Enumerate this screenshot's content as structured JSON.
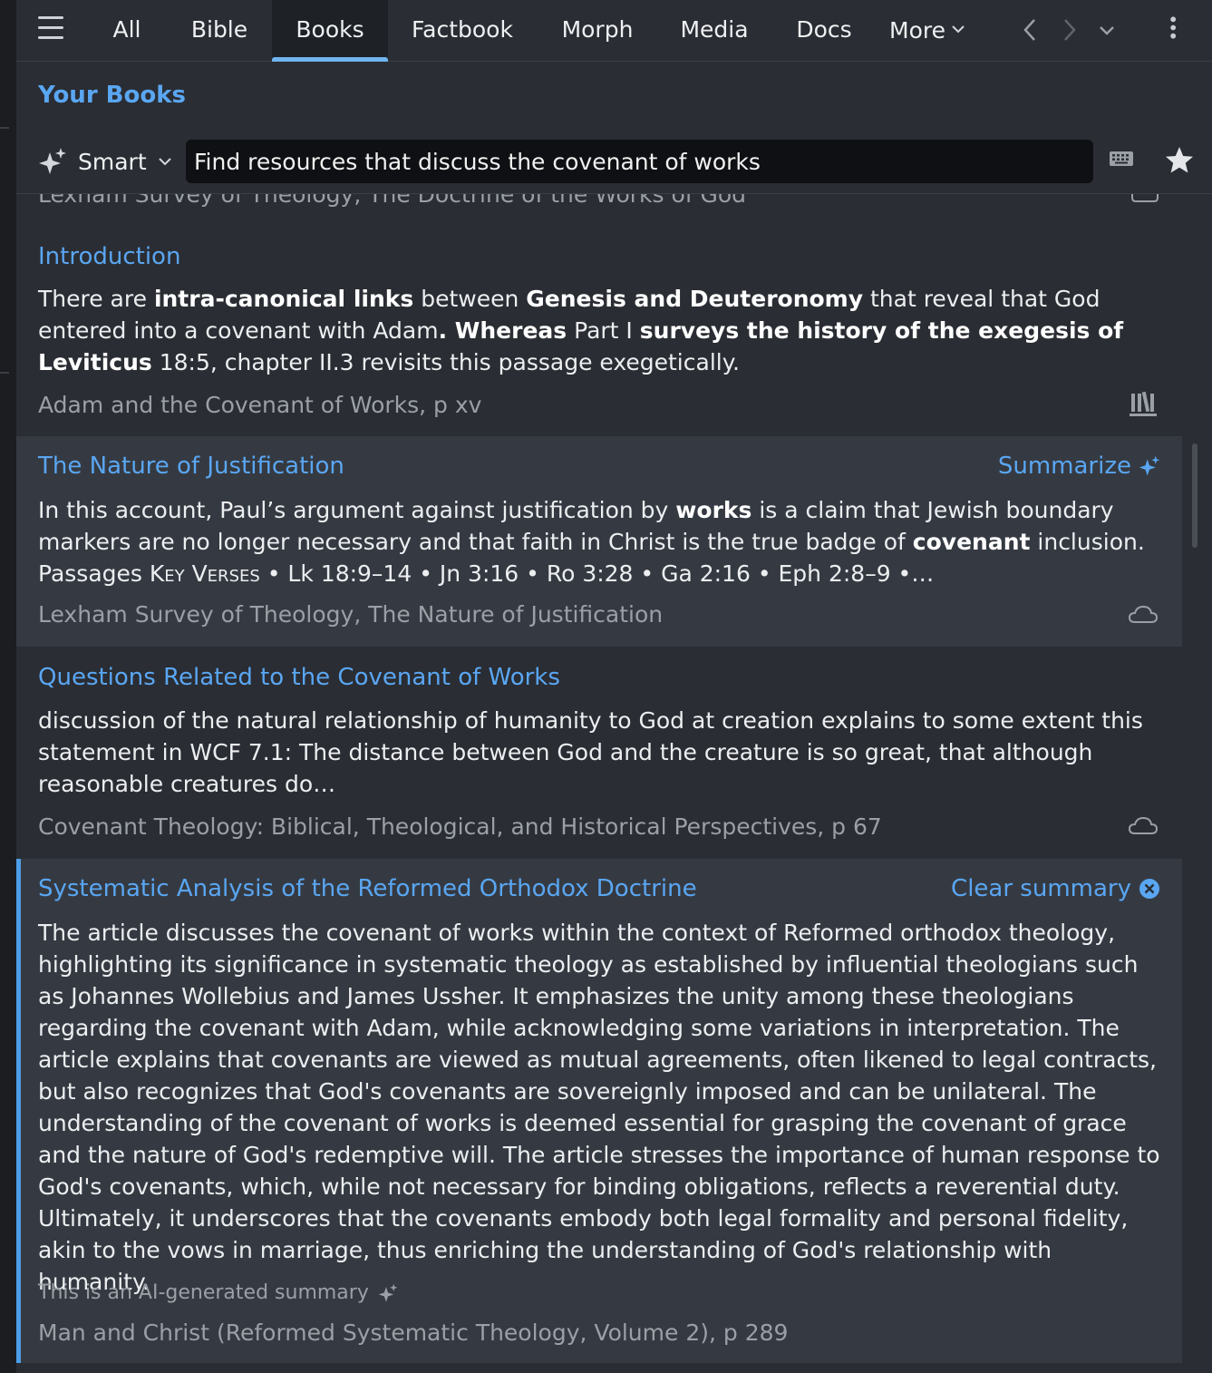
{
  "nav": {
    "tabs": [
      {
        "label": "All"
      },
      {
        "label": "Bible"
      },
      {
        "label": "Books"
      },
      {
        "label": "Factbook"
      },
      {
        "label": "Morph"
      },
      {
        "label": "Media"
      },
      {
        "label": "Docs"
      },
      {
        "label": "More"
      }
    ],
    "active_tab": "Books"
  },
  "header": {
    "title": "Your Books"
  },
  "search": {
    "mode_label": "Smart",
    "query": "Find resources that discuss the covenant of works"
  },
  "results": {
    "cutoff_source": "Lexham Survey of Theology, The Doctrine of the Works of God",
    "items": [
      {
        "title": "Introduction",
        "body": {
          "t1": "There are ",
          "b1": "intra-canonical links",
          "t2": " between ",
          "b2": "Genesis and Deuteronomy",
          "t3": " that reveal that God entered into a covenant with Adam",
          "b3": ". Whereas",
          "t4": " Part I ",
          "b4": "surveys the history of the exegesis of Leviticus",
          "t5": " 18:5, chapter II.3 revisits this passage exegetically."
        },
        "source": "Adam and the Covenant of Works, p xv"
      },
      {
        "title": "The Nature of Justification",
        "action": "Summarize",
        "body": {
          "t1": "In this account, Paul’s argument against justification by ",
          "b1": "works",
          "t2": " is a claim that Jewish boundary markers are no longer necessary and that faith in Christ is the true badge of ",
          "b2": "covenant",
          "t3": " inclusion. Passages ",
          "sc": "Key Verses",
          "t4": " • Lk 18:9–14 • Jn 3:16 • Ro 3:28 • Ga 2:16 • Eph 2:8–9 •…"
        },
        "source": "Lexham Survey of Theology, The Nature of Justification"
      },
      {
        "title": "Questions Related to the Covenant of Works",
        "body": "discussion of the natural relationship of humanity to God at creation explains to some extent this statement in WCF 7.1: The distance between God and the creature is so great, that although reasonable creatures do…",
        "source": "Covenant Theology: Biblical, Theological, and Historical Perspectives, p 67"
      },
      {
        "title": "Systematic Analysis of the Reformed Orthodox Doctrine",
        "action": "Clear summary",
        "body": "The article discusses the covenant of works within the context of Reformed orthodox theology, highlighting its significance in systematic theology as established by influential theologians such as Johannes Wollebius and James Ussher. It emphasizes the unity among these theologians regarding the covenant with Adam, while acknowledging some variations in interpretation. The article explains that covenants are viewed as mutual agreements, often likened to legal contracts, but also recognizes that God's covenants are sovereignly imposed and can be unilateral. The understanding of the covenant of works is deemed essential for grasping the covenant of grace and the nature of God's redemptive will. The article stresses the importance of human response to God's covenants, which, while not necessary for binding obligations, reflects a reverential duty. Ultimately, it underscores that the covenants embody both legal formality and personal fidelity, akin to the vows in marriage, thus enriching the understanding of God's relationship with humanity.",
        "ai_note": "This is an AI-generated summary",
        "source": "Man and Christ (Reformed Systematic Theology, Volume 2), p 289"
      }
    ]
  },
  "colors": {
    "accent": "#5aa6f2",
    "background": "#2a2d33",
    "highlight": "#353a42"
  }
}
